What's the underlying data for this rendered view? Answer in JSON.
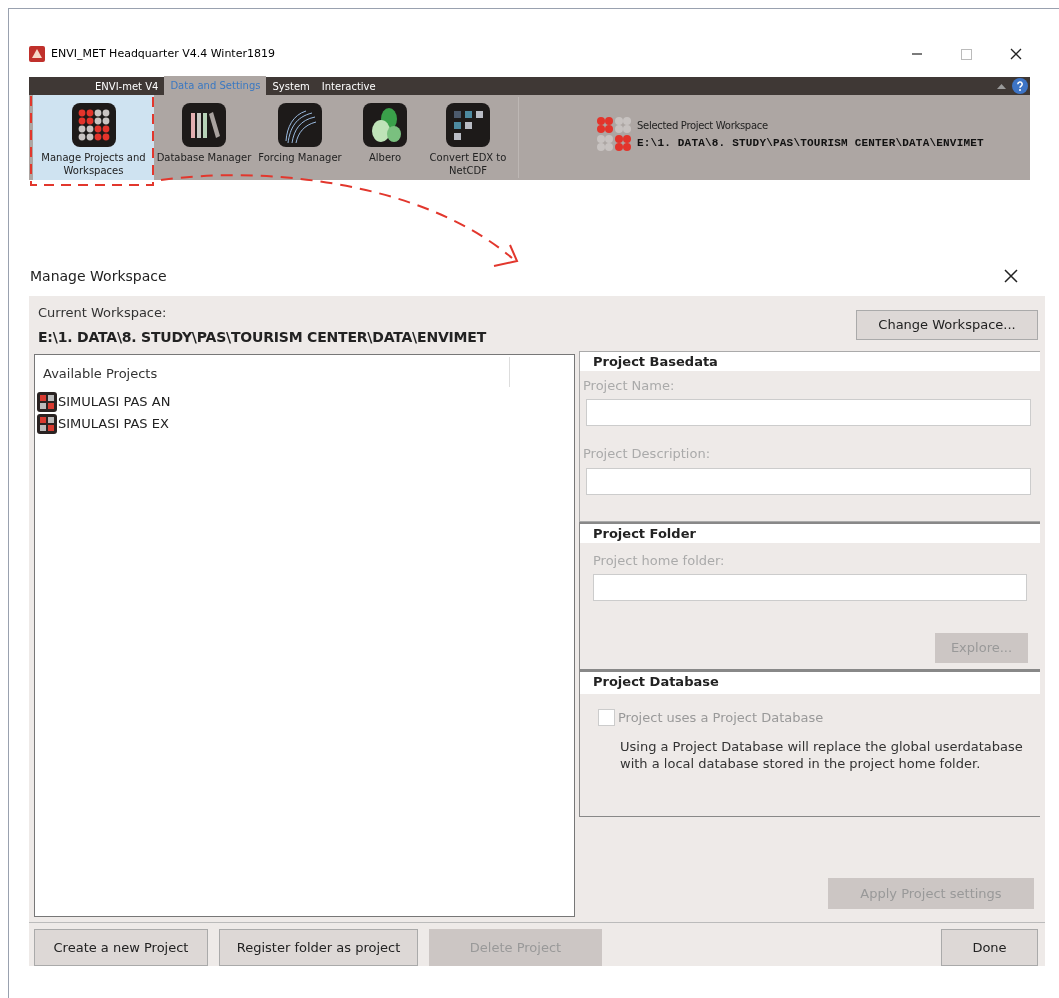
{
  "window": {
    "title": "ENVI_MET Headquarter V4.4 Winter1819"
  },
  "tabs": [
    {
      "label": "ENVI-met V4",
      "selected": false
    },
    {
      "label": "Data and Settings",
      "selected": true
    },
    {
      "label": "System",
      "selected": false
    },
    {
      "label": "Interactive",
      "selected": false
    }
  ],
  "ribbon_buttons": [
    {
      "label": "Manage Projects and Workspaces",
      "kind": "projects",
      "selected": true
    },
    {
      "label": "Database Manager",
      "kind": "database",
      "selected": false
    },
    {
      "label": "Forcing Manager",
      "kind": "forcing",
      "selected": false
    },
    {
      "label": "Albero",
      "kind": "albero",
      "selected": false
    },
    {
      "label": "Convert EDX to NetCDF",
      "kind": "convert",
      "selected": false
    }
  ],
  "selected_workspace": {
    "label": "Selected Project Workspace",
    "path": "E:\\1. DATA\\8. STUDY\\PAS\\TOURISM CENTER\\DATA\\ENVIMET"
  },
  "dialog": {
    "title": "Manage Workspace",
    "current_workspace_label": "Current Workspace:",
    "current_workspace_path": "E:\\1. DATA\\8. STUDY\\PAS\\TOURISM CENTER\\DATA\\ENVIMET",
    "change_button": "Change Workspace...",
    "projects_header": "Available Projects",
    "projects": [
      "SIMULASI PAS AN",
      "SIMULASI PAS EX"
    ],
    "basedata": {
      "header": "Project Basedata",
      "name_label": "Project Name:",
      "description_label": "Project Description:"
    },
    "folder": {
      "header": "Project Folder",
      "home_label": "Project home folder:",
      "explore_button": {
        "label": "Explore...",
        "disabled": true
      }
    },
    "database": {
      "header": "Project Database",
      "checkbox": {
        "label": "Project uses a Project Database",
        "checked": false,
        "disabled": true
      },
      "note": "Using a Project Database will replace the global userdatabase with a local database stored in the project home folder."
    },
    "apply_button": {
      "label": "Apply Project settings",
      "disabled": true
    },
    "buttons": [
      {
        "label": "Create a new Project",
        "disabled": false
      },
      {
        "label": "Register folder as project",
        "disabled": false
      },
      {
        "label": "Delete Project",
        "disabled": true
      }
    ],
    "done_button": {
      "label": "Done",
      "disabled": false
    }
  }
}
